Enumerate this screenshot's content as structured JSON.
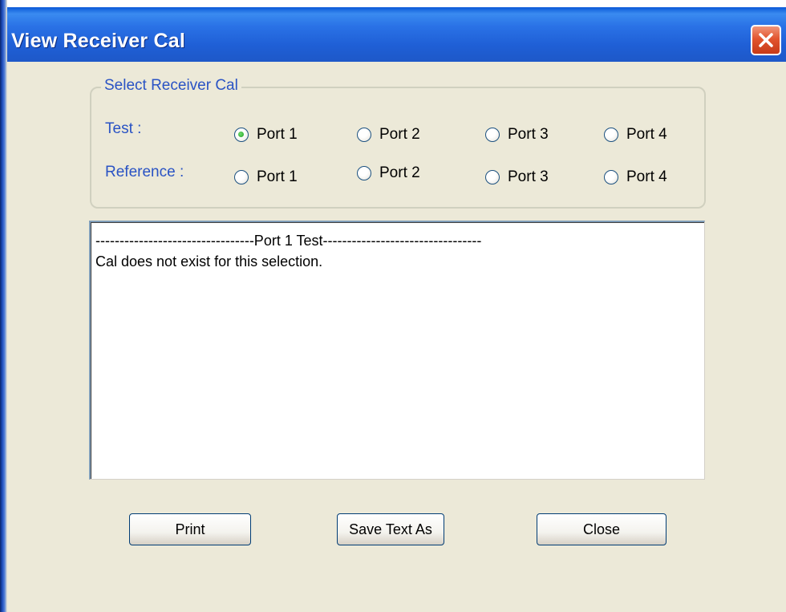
{
  "window": {
    "title": "View Receiver Cal"
  },
  "group": {
    "legend": "Select Receiver Cal",
    "rows": [
      {
        "label": "Test :",
        "options": [
          "Port 1",
          "Port 2",
          "Port 3",
          "Port 4"
        ],
        "selected": "Port 1"
      },
      {
        "label": "Reference :",
        "options": [
          "Port 1",
          "Port 2",
          "Port 3",
          "Port 4"
        ],
        "selected": null
      }
    ]
  },
  "output": {
    "lines": [
      "---------------------------------Port 1 Test---------------------------------",
      "Cal does not exist for this selection."
    ]
  },
  "buttons": {
    "print": "Print",
    "save_text_as": "Save Text As",
    "close": "Close"
  },
  "icons": {
    "close": "close-x-icon"
  },
  "colors": {
    "dialog_bg": "#ECE9D8",
    "titlebar_blue": "#2a72e6",
    "group_text_blue": "#2a53c4",
    "close_red": "#e2552f",
    "radio_selected_green": "#21a121"
  }
}
